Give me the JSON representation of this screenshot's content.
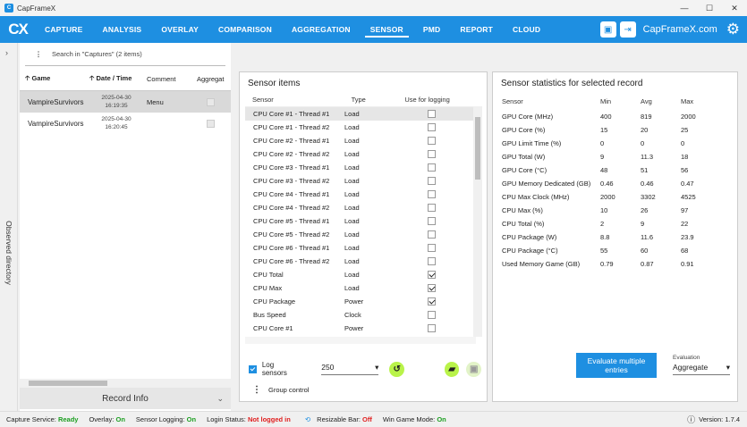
{
  "window": {
    "title": "CapFrameX"
  },
  "nav": {
    "logo": "CX",
    "items": [
      {
        "label": "CAPTURE"
      },
      {
        "label": "ANALYSIS"
      },
      {
        "label": "OVERLAY"
      },
      {
        "label": "COMPARISON"
      },
      {
        "label": "AGGREGATION"
      },
      {
        "label": "SENSOR",
        "active": true
      },
      {
        "label": "PMD"
      },
      {
        "label": "REPORT"
      },
      {
        "label": "CLOUD"
      }
    ],
    "brand": "CapFrameX.com"
  },
  "left_strip": {
    "label": "Observed directory"
  },
  "captures": {
    "search_placeholder": "Search in \"Captures\" (2 items)",
    "columns": [
      "Game",
      "Date / Time",
      "Comment",
      "Aggregat"
    ],
    "rows": [
      {
        "game": "VampireSurvivors",
        "date": "2025-04-30",
        "time": "16:19:35",
        "comment": "Menu"
      },
      {
        "game": "VampireSurvivors",
        "date": "2025-04-30",
        "time": "16:20:45",
        "comment": ""
      }
    ],
    "record_info": "Record Info"
  },
  "sensor_items": {
    "title": "Sensor items",
    "columns": [
      "Sensor",
      "Type",
      "Use for logging"
    ],
    "rows": [
      {
        "name": "CPU Core #1 - Thread #1",
        "type": "Load",
        "checked": false
      },
      {
        "name": "CPU Core #1 - Thread #2",
        "type": "Load",
        "checked": false
      },
      {
        "name": "CPU Core #2 - Thread #1",
        "type": "Load",
        "checked": false
      },
      {
        "name": "CPU Core #2 - Thread #2",
        "type": "Load",
        "checked": false
      },
      {
        "name": "CPU Core #3 - Thread #1",
        "type": "Load",
        "checked": false
      },
      {
        "name": "CPU Core #3 - Thread #2",
        "type": "Load",
        "checked": false
      },
      {
        "name": "CPU Core #4 - Thread #1",
        "type": "Load",
        "checked": false
      },
      {
        "name": "CPU Core #4 - Thread #2",
        "type": "Load",
        "checked": false
      },
      {
        "name": "CPU Core #5 - Thread #1",
        "type": "Load",
        "checked": false
      },
      {
        "name": "CPU Core #5 - Thread #2",
        "type": "Load",
        "checked": false
      },
      {
        "name": "CPU Core #6 - Thread #1",
        "type": "Load",
        "checked": false
      },
      {
        "name": "CPU Core #6 - Thread #2",
        "type": "Load",
        "checked": false
      },
      {
        "name": "CPU Total",
        "type": "Load",
        "checked": true
      },
      {
        "name": "CPU Max",
        "type": "Load",
        "checked": true
      },
      {
        "name": "CPU Package",
        "type": "Power",
        "checked": true
      },
      {
        "name": "Bus Speed",
        "type": "Clock",
        "checked": false
      },
      {
        "name": "CPU Core #1",
        "type": "Power",
        "checked": false
      }
    ],
    "log_sensors_label": "Log sensors",
    "interval_value": "250",
    "group_control_label": "Group control"
  },
  "stats": {
    "title": "Sensor statistics for selected record",
    "columns": [
      "Sensor",
      "Min",
      "Avg",
      "Max"
    ],
    "rows": [
      [
        "GPU Core (MHz)",
        "400",
        "819",
        "2000"
      ],
      [
        "GPU Core (%)",
        "15",
        "20",
        "25"
      ],
      [
        "GPU Limit Time (%)",
        "0",
        "0",
        "0"
      ],
      [
        "GPU Total (W)",
        "9",
        "11.3",
        "18"
      ],
      [
        "GPU Core (°C)",
        "48",
        "51",
        "56"
      ],
      [
        "GPU Memory Dedicated (GB)",
        "0.46",
        "0.46",
        "0.47"
      ],
      [
        "CPU Max Clock (MHz)",
        "2000",
        "3302",
        "4525"
      ],
      [
        "CPU Max (%)",
        "10",
        "26",
        "97"
      ],
      [
        "CPU Total (%)",
        "2",
        "9",
        "22"
      ],
      [
        "CPU Package (W)",
        "8.8",
        "11.6",
        "23.9"
      ],
      [
        "CPU Package (°C)",
        "55",
        "60",
        "68"
      ],
      [
        "Used Memory Game (GB)",
        "0.79",
        "0.87",
        "0.91"
      ]
    ],
    "evaluate_label": "Evaluate multiple entries",
    "evaluation_label": "Evaluation",
    "evaluation_value": "Aggregate"
  },
  "status": {
    "capture_service_label": "Capture Service:",
    "capture_service_value": "Ready",
    "overlay_label": "Overlay:",
    "overlay_value": "On",
    "sensor_logging_label": "Sensor Logging:",
    "sensor_logging_value": "On",
    "login_label": "Login Status:",
    "login_value": "Not logged in",
    "resizable_label": "Resizable Bar:",
    "resizable_value": "Off",
    "gamemode_label": "Win Game Mode:",
    "gamemode_value": "On",
    "version_label": "Version:",
    "version_value": "1.7.4"
  },
  "colors": {
    "accent": "#1e8fe1",
    "lime": "#b9f34a",
    "ok": "#1b9e20",
    "bad": "#e02020"
  }
}
